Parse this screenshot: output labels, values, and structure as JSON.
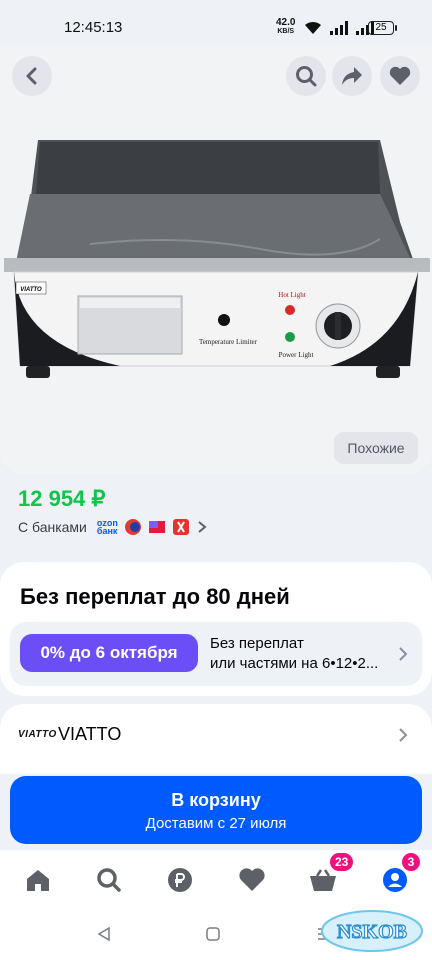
{
  "status_bar": {
    "time": "12:45:13",
    "net_speed": "42.0",
    "net_unit": "KB/S",
    "battery": "25"
  },
  "product": {
    "image_labels": {
      "brand": "VIATTO",
      "hot_light": "Hot Light",
      "power_light": "Power Light",
      "temp_limiter": "Temperature Limiter"
    },
    "similar_label": "Похожие",
    "price": "12 954 ₽",
    "banks_label": "С банками",
    "ozon_bank_line1": "ozon",
    "ozon_bank_line2": "банк"
  },
  "installment": {
    "title": "Без переплат до 80 дней",
    "badge": "0% до 6 октября",
    "text_line1": "Без переплат",
    "text_line2": "или частями на 6•12•2..."
  },
  "brand": {
    "logo_text": "VIATTO",
    "name": "VIATTO"
  },
  "cart": {
    "label": "В корзину",
    "delivery": "Доставим с 27 июля"
  },
  "bottom_nav": {
    "cart_badge": "23",
    "profile_badge": "3"
  },
  "watermark": "NSKOB",
  "colors": {
    "accent": "#005bff",
    "price_green": "#10c44c",
    "installment_purple": "#6b4ef5",
    "badge_pink": "#f1117e"
  }
}
